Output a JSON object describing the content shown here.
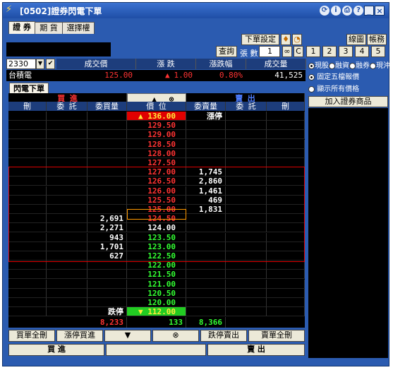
{
  "window": {
    "title": "[0502]證券閃電下單"
  },
  "tabs": [
    {
      "label": "證 券",
      "active": true
    },
    {
      "label": "期 貨",
      "active": false
    },
    {
      "label": "選擇權",
      "active": false
    }
  ],
  "toolbar": {
    "order_settings": "下單設定",
    "query": "查詢",
    "lots_label": "張 數",
    "lots_value": "1",
    "c_label": "C",
    "chart": "線圖",
    "account": "帳務",
    "qty_buttons": [
      "1",
      "2",
      "3",
      "4",
      "5"
    ]
  },
  "symbol": {
    "code": "2330",
    "name": "台積電"
  },
  "quote_header": {
    "last": "成交價",
    "change": "漲 跌",
    "pct": "漲跌幅",
    "volume": "成交量"
  },
  "quote": {
    "last": "125.00",
    "change_arrow": "▲",
    "change": "1.00",
    "pct": "0.80%",
    "volume": "41,525"
  },
  "right_options": {
    "modes": [
      {
        "label": "現股",
        "selected": true
      },
      {
        "label": "融資",
        "selected": false
      },
      {
        "label": "融券",
        "selected": false
      },
      {
        "label": "現沖",
        "selected": false
      }
    ],
    "fixed5": "固定五檔報價",
    "showall": "顯示所有價格",
    "add_stock": "加入證券商品"
  },
  "subtab": "閃電下單",
  "grid_header": {
    "buy": "買 進",
    "sell": "賣 出",
    "up_arrow": "▲",
    "center_icon": "⊗",
    "cols": [
      "刪",
      "委 託",
      "委買量",
      "價 位",
      "委賣量",
      "委 託",
      "刪"
    ]
  },
  "ladder": [
    {
      "price": "▲ 136.00",
      "bid": "",
      "ask": "漲停",
      "price_color": "#ffeb3b",
      "price_bg": "#e00000"
    },
    {
      "price": "129.50",
      "bid": "",
      "ask": "",
      "price_color": "#ff3333",
      "price_bg": "#000"
    },
    {
      "price": "129.00",
      "bid": "",
      "ask": "",
      "price_color": "#ff3333",
      "price_bg": "#000"
    },
    {
      "price": "128.50",
      "bid": "",
      "ask": "",
      "price_color": "#ff3333",
      "price_bg": "#000"
    },
    {
      "price": "128.00",
      "bid": "",
      "ask": "",
      "price_color": "#ff3333",
      "price_bg": "#000"
    },
    {
      "price": "127.50",
      "bid": "",
      "ask": "",
      "price_color": "#ff3333",
      "price_bg": "#000"
    },
    {
      "price": "127.00",
      "bid": "",
      "ask": "1,745",
      "price_color": "#ff3333",
      "price_bg": "#000"
    },
    {
      "price": "126.50",
      "bid": "",
      "ask": "2,860",
      "price_color": "#ff3333",
      "price_bg": "#000"
    },
    {
      "price": "126.00",
      "bid": "",
      "ask": "1,461",
      "price_color": "#ff3333",
      "price_bg": "#000"
    },
    {
      "price": "125.50",
      "bid": "",
      "ask": "469",
      "price_color": "#ff3333",
      "price_bg": "#000"
    },
    {
      "price": "125.00",
      "bid": "",
      "ask": "1,831",
      "price_color": "#ff3333",
      "price_bg": "#000"
    },
    {
      "price": "124.50",
      "bid": "2,691",
      "ask": "",
      "price_color": "#ff3333",
      "price_bg": "#000"
    },
    {
      "price": "124.00",
      "bid": "2,271",
      "ask": "",
      "price_color": "#ffffff",
      "price_bg": "#000"
    },
    {
      "price": "123.50",
      "bid": "943",
      "ask": "",
      "price_color": "#33ff33",
      "price_bg": "#000"
    },
    {
      "price": "123.00",
      "bid": "1,701",
      "ask": "",
      "price_color": "#33ff33",
      "price_bg": "#000"
    },
    {
      "price": "122.50",
      "bid": "627",
      "ask": "",
      "price_color": "#33ff33",
      "price_bg": "#000"
    },
    {
      "price": "122.00",
      "bid": "",
      "ask": "",
      "price_color": "#33ff33",
      "price_bg": "#000"
    },
    {
      "price": "121.50",
      "bid": "",
      "ask": "",
      "price_color": "#33ff33",
      "price_bg": "#000"
    },
    {
      "price": "121.00",
      "bid": "",
      "ask": "",
      "price_color": "#33ff33",
      "price_bg": "#000"
    },
    {
      "price": "120.50",
      "bid": "",
      "ask": "",
      "price_color": "#33ff33",
      "price_bg": "#000"
    },
    {
      "price": "120.00",
      "bid": "",
      "ask": "",
      "price_color": "#33ff33",
      "price_bg": "#000"
    },
    {
      "price": "▼ 112.00",
      "bid": "跌停",
      "ask": "",
      "price_color": "#ffeb3b",
      "price_bg": "#22cc22"
    }
  ],
  "totals": {
    "bid_total": "8,233",
    "mid_total": "133",
    "ask_total": "8,366"
  },
  "bottom_buttons": {
    "cancel_all_buy": "買單全刪",
    "limit_up_buy": "漲停買進",
    "down": "▼",
    "center": "⊗",
    "limit_down_sell": "跌停賣出",
    "cancel_all_sell": "賣單全刪"
  },
  "action": {
    "buy": "買 進",
    "sell": "賣 出"
  }
}
